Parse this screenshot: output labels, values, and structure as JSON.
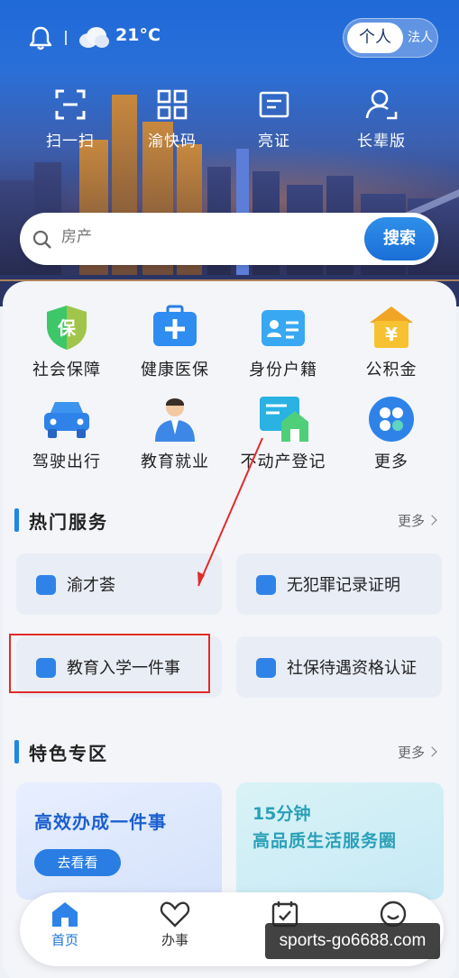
{
  "header": {
    "weather": {
      "temperature": "21°C",
      "icon": "cloud-icon"
    },
    "account_switch": {
      "active": "个人",
      "inactive": "法人"
    },
    "quick_actions": [
      {
        "label": "扫一扫",
        "icon": "scan-icon"
      },
      {
        "label": "渝快码",
        "icon": "qr-code-icon"
      },
      {
        "label": "亮证",
        "icon": "id-card-icon"
      },
      {
        "label": "长辈版",
        "icon": "elder-user-icon"
      }
    ],
    "search": {
      "placeholder": "房产",
      "button": "搜索"
    }
  },
  "services": [
    {
      "label": "社会保障",
      "icon": "shield-icon",
      "badge": "保"
    },
    {
      "label": "健康医保",
      "icon": "medical-kit-icon"
    },
    {
      "label": "身份户籍",
      "icon": "id-card-icon"
    },
    {
      "label": "公积金",
      "icon": "house-fund-icon",
      "badge": "¥"
    },
    {
      "label": "驾驶出行",
      "icon": "car-icon"
    },
    {
      "label": "教育就业",
      "icon": "person-icon"
    },
    {
      "label": "不动产登记",
      "icon": "property-icon"
    },
    {
      "label": "更多",
      "icon": "more-grid-icon"
    }
  ],
  "hot_services": {
    "title": "热门服务",
    "more": "更多",
    "items": [
      {
        "label": "渝才荟"
      },
      {
        "label": "无犯罪记录证明"
      },
      {
        "label": "教育入学一件事"
      },
      {
        "label": "社保待遇资格认证"
      }
    ]
  },
  "featured": {
    "title": "特色专区",
    "more": "更多",
    "cards": [
      {
        "title": "高效办成一件事",
        "button": "去看看"
      },
      {
        "line1": "15分钟",
        "line2": "高品质生活服务圈"
      }
    ]
  },
  "bottom_nav": [
    {
      "label": "首页",
      "icon": "home-icon",
      "active": true
    },
    {
      "label": "办事",
      "icon": "heart-icon",
      "active": false
    },
    {
      "label": "",
      "icon": "calendar-check-icon",
      "active": false
    },
    {
      "label": "",
      "icon": "smile-icon",
      "active": false
    }
  ],
  "watermark": "sports-go6688.com",
  "colors": {
    "accent": "#1e88e5",
    "highlight_box": "#e02b2b"
  }
}
